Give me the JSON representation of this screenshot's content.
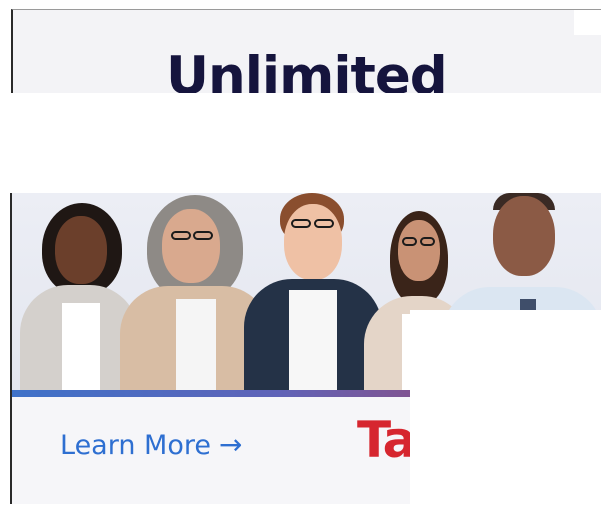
{
  "top_banner": {
    "headline": "Unlimited"
  },
  "bottom_ad": {
    "cta_label": "Learn More",
    "cta_arrow": "→",
    "brand_fragment": "Ta",
    "colors": {
      "headline": "#15143d",
      "cta": "#2e6fd1",
      "brand": "#d6262f",
      "accent_line_start": "#3f72c9",
      "accent_line_end": "#c2345a"
    }
  },
  "icons": {
    "cta_arrow_icon": "arrow-right-icon"
  }
}
